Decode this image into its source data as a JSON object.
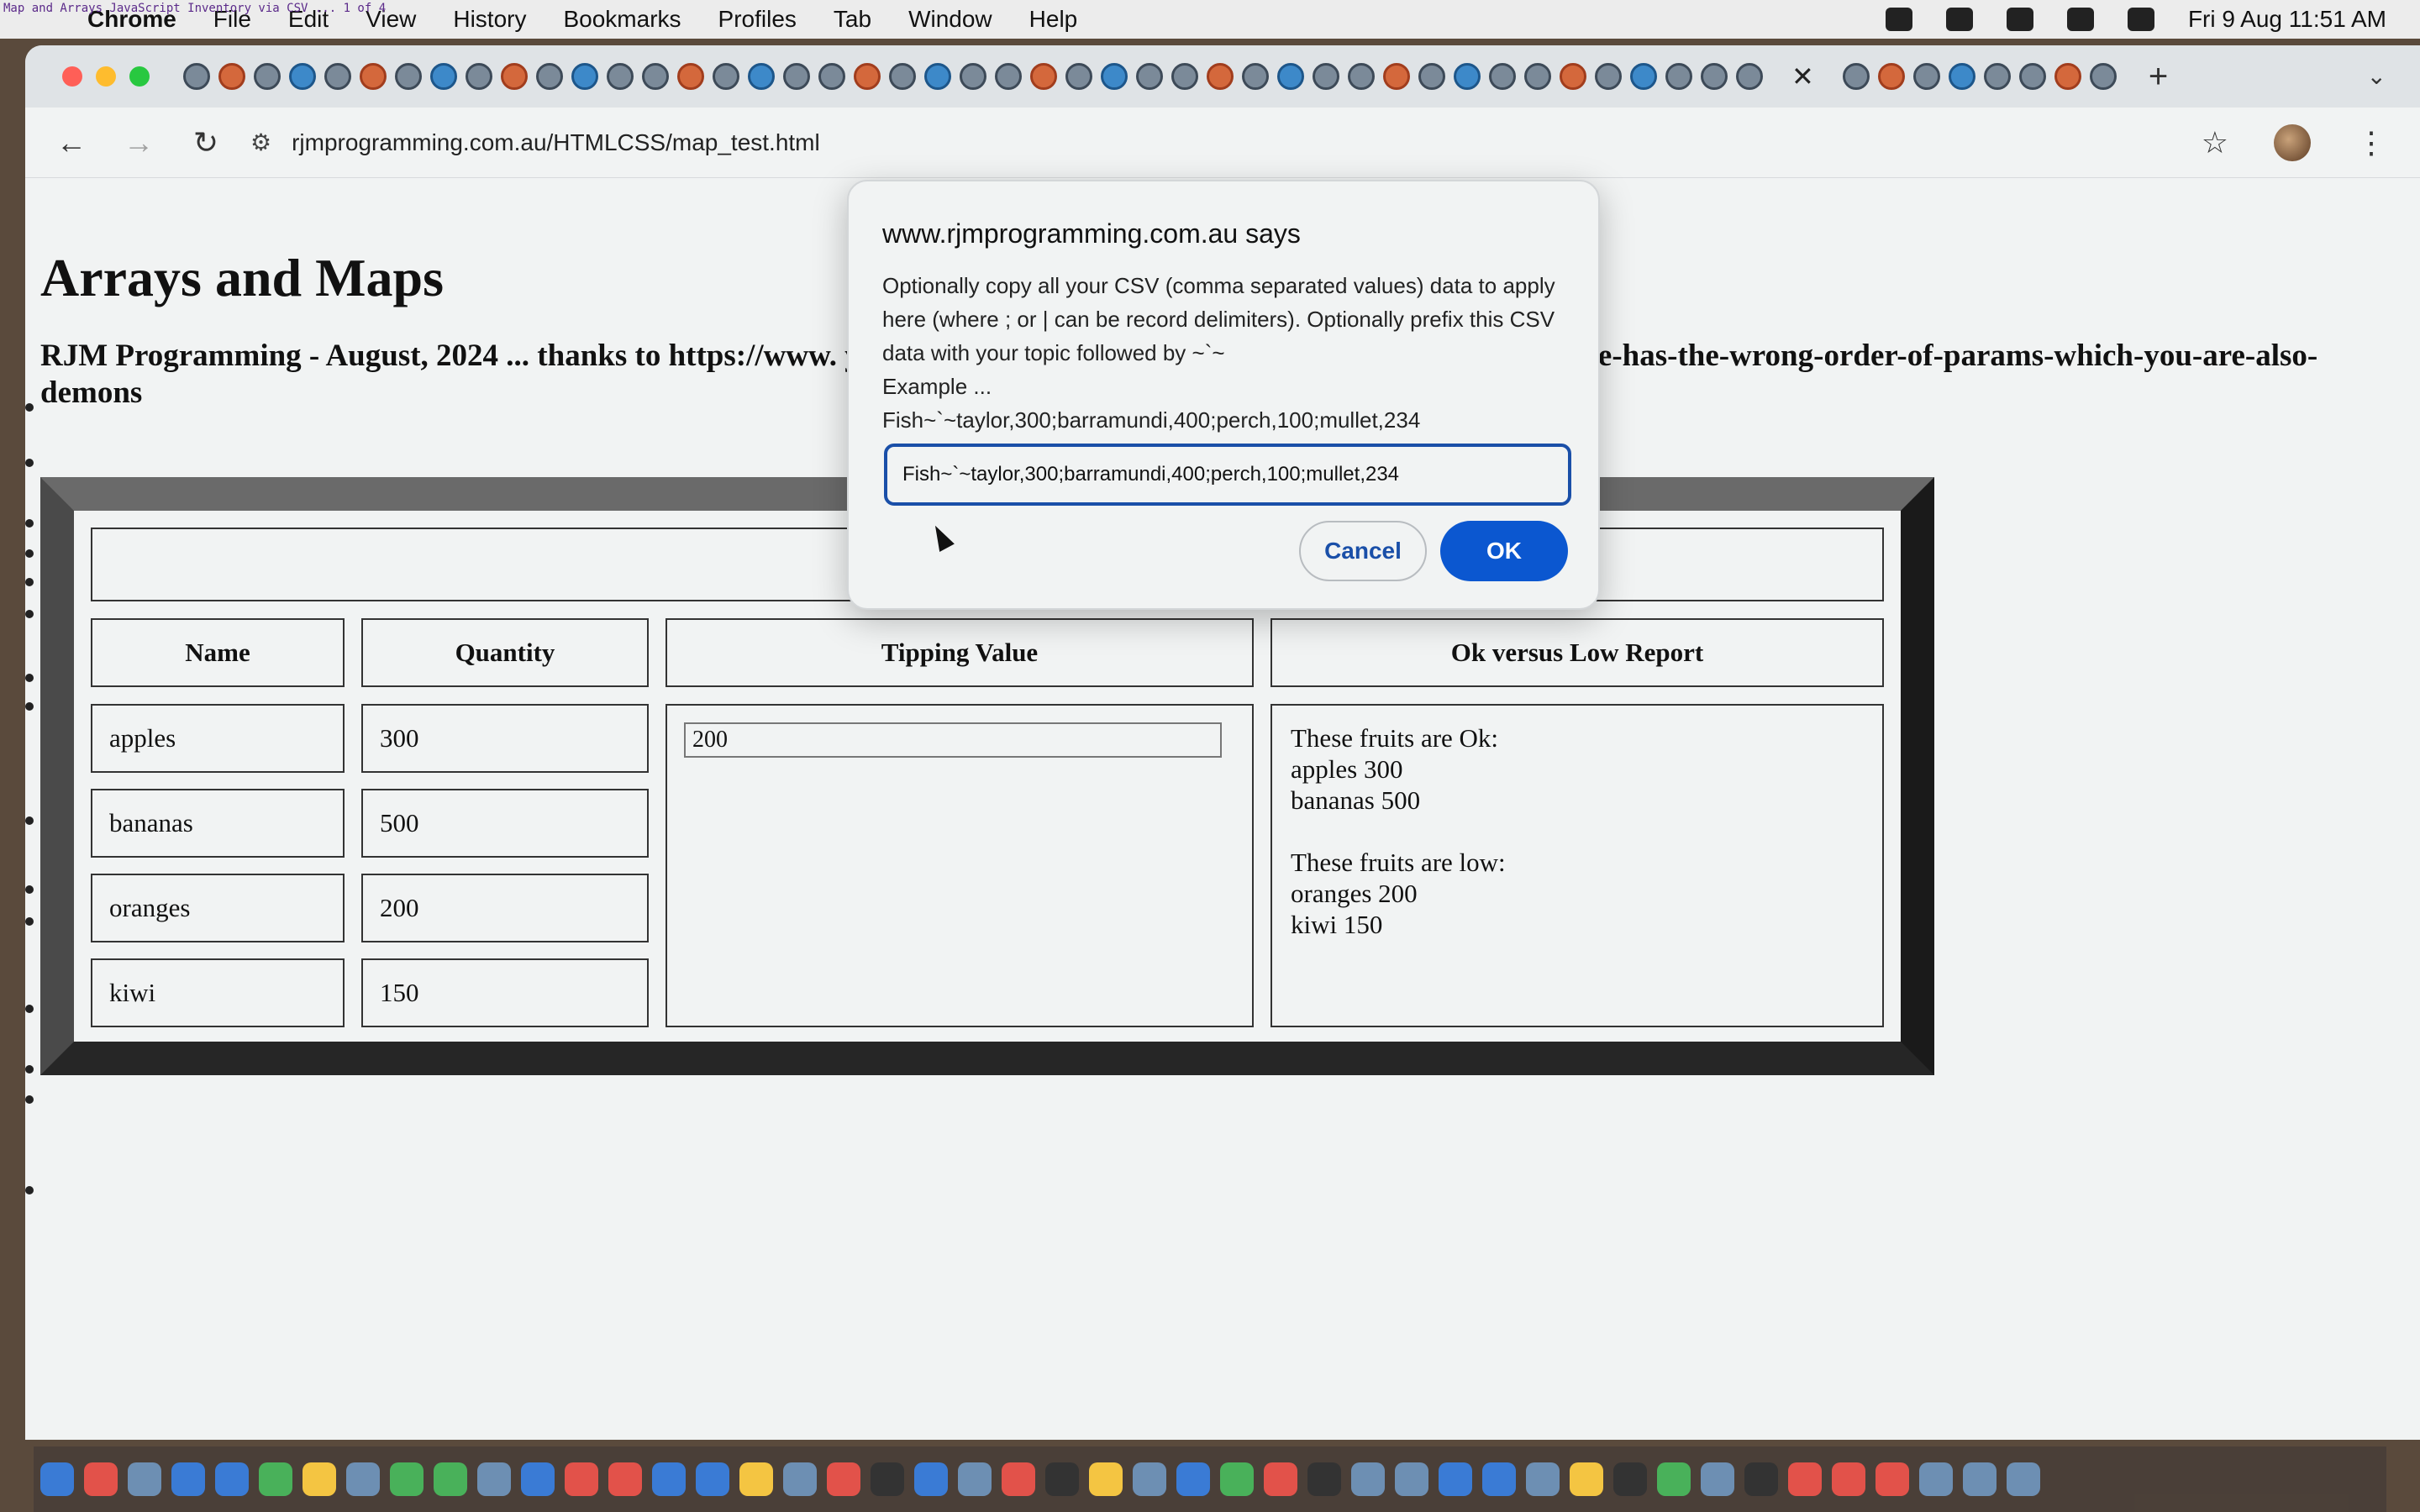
{
  "menubar": {
    "tiny_title": "Map and Arrays JavaScript Inventory via CSV ... 1 of 4",
    "app": "Chrome",
    "items": [
      "File",
      "Edit",
      "View",
      "History",
      "Bookmarks",
      "Profiles",
      "Tab",
      "Window",
      "Help"
    ],
    "clock": "Fri 9 Aug  11:51 AM"
  },
  "toolbar": {
    "url": "rjmprogramming.com.au/HTMLCSS/map_test.html"
  },
  "page": {
    "heading": "Arrays and Maps",
    "subheading": "RJM Programming - August, 2024 ... thanks to https://www.                                                                                                  y and https://medium.com/@sotoer/your-foreach-example-has-the-wrong-order-of-params-which-you-are-also-demons",
    "table": {
      "headers": [
        "Name",
        "Quantity",
        "Tipping Value",
        "Ok versus Low Report"
      ],
      "rows": [
        {
          "name": "apples",
          "quantity": "300"
        },
        {
          "name": "bananas",
          "quantity": "500"
        },
        {
          "name": "oranges",
          "quantity": "200"
        },
        {
          "name": "kiwi",
          "quantity": "150"
        }
      ],
      "tipping_value": "200",
      "report": "These fruits are Ok:\napples 300\nbananas 500\n\nThese fruits are low:\noranges 200\nkiwi 150"
    }
  },
  "dialog": {
    "title": "www.rjmprogramming.com.au says",
    "message": "Optionally copy all your CSV (comma separated values) data to apply here (where ; or | can be record delimiters).  Optionally prefix this CSV data with your topic followed by ~`~\nExample ...\nFish~`~taylor,300;barramundi,400;perch,100;mullet,234",
    "input_value": "Fish~`~taylor,300;barramundi,400;perch,100;mullet,234",
    "cancel_label": "Cancel",
    "ok_label": "OK"
  },
  "icons": {
    "back": "back-arrow-icon",
    "forward": "forward-arrow-icon",
    "reload": "reload-icon",
    "site_info": "site-info-icon",
    "bookmark": "star-icon",
    "menu": "kebab-menu-icon"
  },
  "colors": {
    "dialog_ok": "#0b57d0",
    "dialog_focus": "#1a4fa8"
  }
}
